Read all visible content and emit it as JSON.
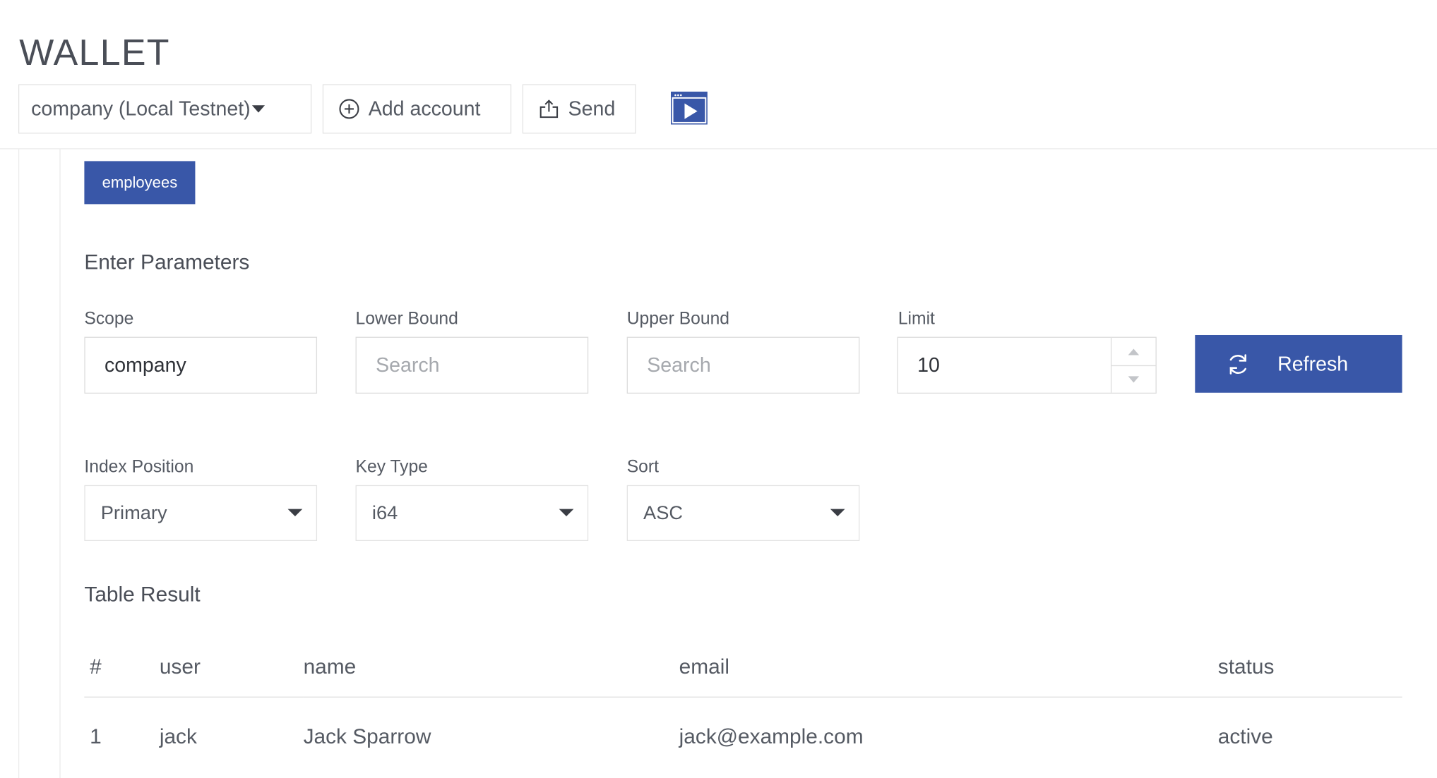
{
  "app": {
    "title": "WALLET"
  },
  "header": {
    "account_selector": "company (Local Testnet)",
    "add_account_label": "Add account",
    "send_label": "Send"
  },
  "table_chip": "employees",
  "params": {
    "title": "Enter Parameters",
    "scope": {
      "label": "Scope",
      "value": "company"
    },
    "lower_bound": {
      "label": "Lower Bound",
      "placeholder": "Search"
    },
    "upper_bound": {
      "label": "Upper Bound",
      "placeholder": "Search"
    },
    "limit": {
      "label": "Limit",
      "value": "10"
    },
    "refresh_label": "Refresh",
    "index_position": {
      "label": "Index Position",
      "value": "Primary"
    },
    "key_type": {
      "label": "Key Type",
      "value": "i64"
    },
    "sort": {
      "label": "Sort",
      "value": "ASC"
    }
  },
  "result": {
    "title": "Table Result",
    "columns": [
      "#",
      "user",
      "name",
      "email",
      "status"
    ],
    "rows": [
      [
        "1",
        "jack",
        "Jack Sparrow",
        "jack@example.com",
        "active"
      ]
    ]
  },
  "colors": {
    "accent": "#3957a8",
    "text": "#555a63",
    "border": "#dcdcdc"
  }
}
